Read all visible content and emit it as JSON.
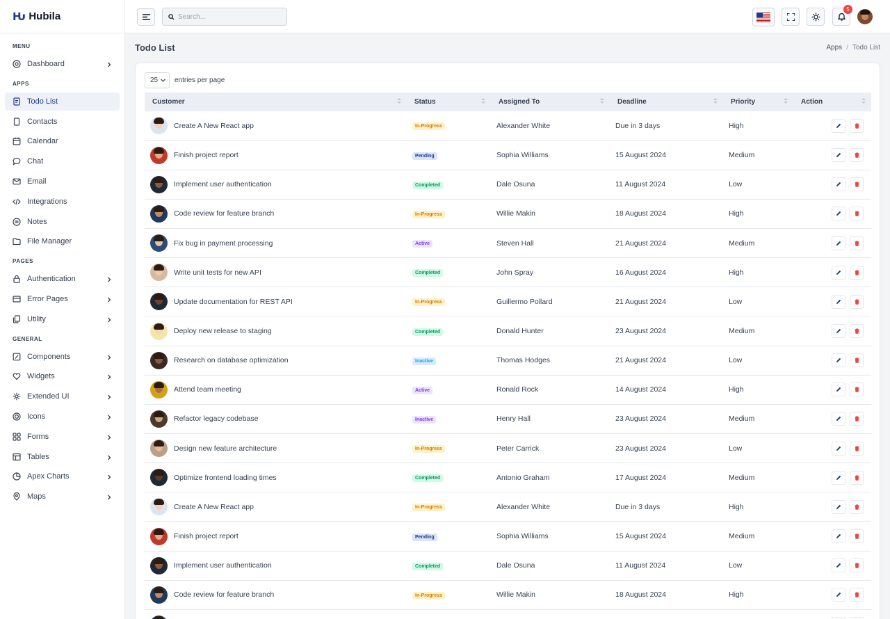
{
  "brand": {
    "logo": "Ƕ",
    "name": "Hubila"
  },
  "search": {
    "placeholder": "Search..."
  },
  "notifications": {
    "count": "5"
  },
  "sidebar": {
    "sections": [
      {
        "title": "MENU",
        "items": [
          {
            "label": "Dashboard",
            "icon": "dashboard-icon",
            "chevron": true
          }
        ]
      },
      {
        "title": "APPS",
        "items": [
          {
            "label": "Todo List",
            "icon": "todo-icon",
            "chevron": false,
            "active": true
          },
          {
            "label": "Contacts",
            "icon": "contacts-icon",
            "chevron": false
          },
          {
            "label": "Calendar",
            "icon": "calendar-icon",
            "chevron": false
          },
          {
            "label": "Chat",
            "icon": "chat-icon",
            "chevron": false
          },
          {
            "label": "Email",
            "icon": "email-icon",
            "chevron": false
          },
          {
            "label": "Integrations",
            "icon": "code-icon",
            "chevron": false
          },
          {
            "label": "Notes",
            "icon": "notes-icon",
            "chevron": false
          },
          {
            "label": "File Manager",
            "icon": "folder-icon",
            "chevron": false
          }
        ]
      },
      {
        "title": "PAGES",
        "items": [
          {
            "label": "Authentication",
            "icon": "lock-icon",
            "chevron": true
          },
          {
            "label": "Error Pages",
            "icon": "error-icon",
            "chevron": true
          },
          {
            "label": "Utility",
            "icon": "utility-icon",
            "chevron": true
          }
        ]
      },
      {
        "title": "GENERAL",
        "items": [
          {
            "label": "Components",
            "icon": "components-icon",
            "chevron": true
          },
          {
            "label": "Widgets",
            "icon": "widgets-icon",
            "chevron": true
          },
          {
            "label": "Extended UI",
            "icon": "extended-icon",
            "chevron": true
          },
          {
            "label": "Icons",
            "icon": "icons-icon",
            "chevron": true
          },
          {
            "label": "Forms",
            "icon": "forms-icon",
            "chevron": true
          },
          {
            "label": "Tables",
            "icon": "tables-icon",
            "chevron": true
          },
          {
            "label": "Apex Charts",
            "icon": "charts-icon",
            "chevron": true
          },
          {
            "label": "Maps",
            "icon": "map-pin-icon",
            "chevron": true
          }
        ]
      }
    ]
  },
  "page": {
    "title": "Todo List",
    "breadcrumb": [
      "Apps",
      "Todo List"
    ]
  },
  "table": {
    "entries_value": "25",
    "entries_label": "entries per page",
    "columns": [
      "Customer",
      "Status",
      "Assigned To",
      "Deadline",
      "Priority",
      "Action"
    ],
    "status_colors": {
      "In-Progress": {
        "bg": "#fef3c7",
        "fg": "#d97706"
      },
      "Pending": {
        "bg": "#dbe3f8",
        "fg": "#1e3a8a"
      },
      "Completed": {
        "bg": "#d1fae5",
        "fg": "#059669"
      },
      "Active": {
        "bg": "#ede4fb",
        "fg": "#7c3aed"
      },
      "Inactive": {
        "bg": "#dbeafe",
        "fg": "#0ea5e9"
      }
    },
    "inactive_purple_rows": [
      10
    ],
    "rows": [
      {
        "task": "Create A New React app",
        "status": "In-Progress",
        "assigned": "Alexander White",
        "deadline": "Due in 3 days",
        "priority": "High",
        "avatar": "#dbe4ef"
      },
      {
        "task": "Finish project report",
        "status": "Pending",
        "assigned": "Sophia Williams",
        "deadline": "15 August 2024",
        "priority": "Medium",
        "avatar": "#c0392b"
      },
      {
        "task": "Implement user authentication",
        "status": "Completed",
        "assigned": "Dale Osuna",
        "deadline": "11 August 2024",
        "priority": "Low",
        "avatar": "#1f2937"
      },
      {
        "task": "Code review for feature branch",
        "status": "In-Progress",
        "assigned": "Willie Makin",
        "deadline": "18 August 2024",
        "priority": "High",
        "avatar": "#1e3a5f"
      },
      {
        "task": "Fix bug in payment processing",
        "status": "Active",
        "assigned": "Steven Hall",
        "deadline": "21 August 2024",
        "priority": "Medium",
        "avatar": "#2c4a7a"
      },
      {
        "task": "Write unit tests for new API",
        "status": "Completed",
        "assigned": "John Spray",
        "deadline": "16 August 2024",
        "priority": "High",
        "avatar": "#d7b8a0"
      },
      {
        "task": "Update documentation for REST API",
        "status": "In-Progress",
        "assigned": "Guillermo Pollard",
        "deadline": "21 August 2024",
        "priority": "Low",
        "avatar": "#1f2937"
      },
      {
        "task": "Deploy new release to staging",
        "status": "Completed",
        "assigned": "Donald Hunter",
        "deadline": "23 August 2024",
        "priority": "Medium",
        "avatar": "#f5e6a8"
      },
      {
        "task": "Research on database optimization",
        "status": "Inactive",
        "assigned": "Thomas Hodges",
        "deadline": "21 August 2024",
        "priority": "Low",
        "avatar": "#3b2a22"
      },
      {
        "task": "Attend team meeting",
        "status": "Active",
        "assigned": "Ronald Rock",
        "deadline": "14 August 2024",
        "priority": "High",
        "avatar": "#d4a017"
      },
      {
        "task": "Refactor legacy codebase",
        "status": "Inactive",
        "assigned": "Henry Hall",
        "deadline": "23 August 2024",
        "priority": "Medium",
        "avatar": "#4a3a30"
      },
      {
        "task": "Design new feature architecture",
        "status": "In-Progress",
        "assigned": "Peter Carrick",
        "deadline": "23 August 2024",
        "priority": "Low",
        "avatar": "#b9a08a"
      },
      {
        "task": "Optimize frontend loading times",
        "status": "Completed",
        "assigned": "Antonio Graham",
        "deadline": "17 August 2024",
        "priority": "Medium",
        "avatar": "#1f2937"
      },
      {
        "task": "Create A New React app",
        "status": "In-Progress",
        "assigned": "Alexander White",
        "deadline": "Due in 3 days",
        "priority": "High",
        "avatar": "#dbe4ef"
      },
      {
        "task": "Finish project report",
        "status": "Pending",
        "assigned": "Sophia Williams",
        "deadline": "15 August 2024",
        "priority": "Medium",
        "avatar": "#c0392b"
      },
      {
        "task": "Implement user authentication",
        "status": "Completed",
        "assigned": "Dale Osuna",
        "deadline": "11 August 2024",
        "priority": "Low",
        "avatar": "#1f2937"
      },
      {
        "task": "Code review for feature branch",
        "status": "In-Progress",
        "assigned": "Willie Makin",
        "deadline": "18 August 2024",
        "priority": "High",
        "avatar": "#1e3a5f"
      },
      {
        "task": "",
        "status": "",
        "assigned": "",
        "deadline": "",
        "priority": "",
        "avatar": "#1e3a5f"
      }
    ]
  }
}
